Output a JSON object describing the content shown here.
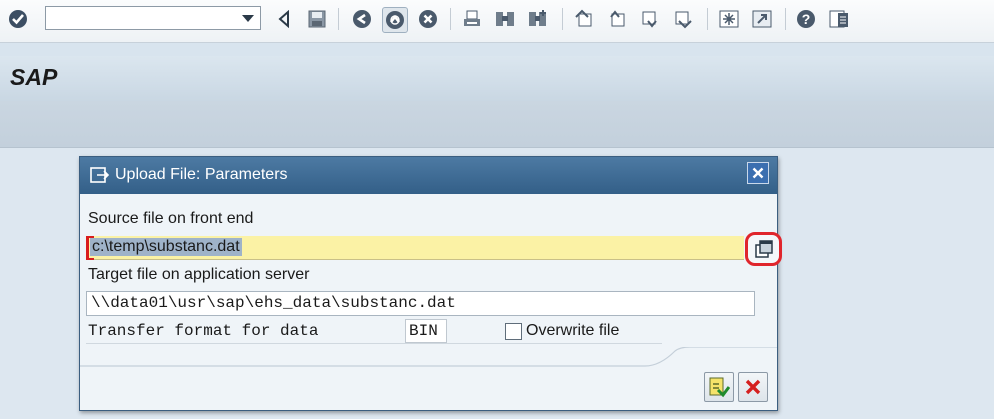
{
  "toolbar": {
    "icons": [
      "enter-icon",
      "back-icon",
      "save-icon",
      "back-arrow-icon",
      "exit-icon",
      "cancel-icon",
      "print-icon",
      "find-icon",
      "find-next-icon",
      "first-page-icon",
      "previous-page-icon",
      "next-page-icon",
      "last-page-icon",
      "create-session-icon",
      "shortcut-icon",
      "help-icon",
      "customize-layout-icon"
    ],
    "command_field": {
      "value": "",
      "placeholder": ""
    }
  },
  "titlebar": {
    "title": "SAP"
  },
  "dialog": {
    "title": "Upload File: Parameters",
    "source_label": "Source file on front end",
    "source_value": "c:\\temp\\substanc.dat",
    "target_label": "Target file on application server",
    "target_value": "\\\\data01\\usr\\sap\\ehs_data\\substanc.dat",
    "format_label": "Transfer format for data",
    "format_value": "BIN",
    "overwrite_label": "Overwrite file",
    "overwrite_checked": false
  },
  "colors": {
    "dialog_header": "#3f6b94",
    "required_field": "#fbf2a5",
    "highlight_ring": "#e0252c"
  }
}
